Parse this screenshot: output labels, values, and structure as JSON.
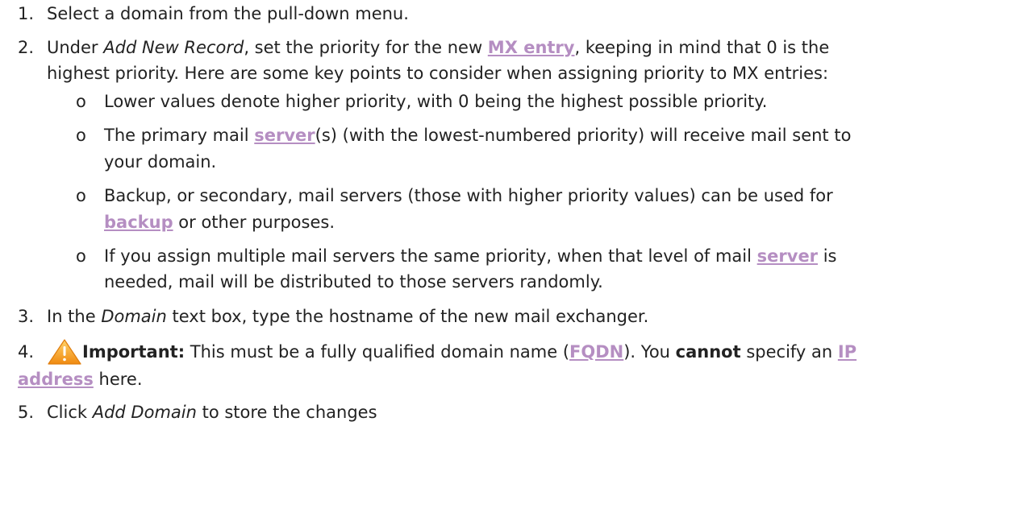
{
  "steps": [
    {
      "number": "1.",
      "text": "Select a domain from the pull-down menu."
    },
    {
      "number": "2.",
      "line1": {
        "pre": "Under ",
        "italic": "Add New Record",
        "mid": ", set the priority for the new ",
        "link": "MX entry",
        "post": ", keeping in mind that 0 is the"
      },
      "line2": "highest priority. Here are some key points to consider when assigning priority to MX entries:",
      "bullets": [
        {
          "marker": "o",
          "line1": "Lower values denote higher priority, with 0 being the highest possible priority."
        },
        {
          "marker": "o",
          "line1_pre": "The primary mail ",
          "line1_link": "server",
          "line1_post": "(s) (with the lowest-numbered priority) will receive mail sent to",
          "line2": "your domain."
        },
        {
          "marker": "o",
          "line1": "Backup, or secondary, mail servers (those with higher priority values) can be used for",
          "line2_link": "backup",
          "line2_post": " or other purposes."
        },
        {
          "marker": "o",
          "line1_pre": "If you assign multiple mail servers the same priority, when that level of mail ",
          "line1_link": "server",
          "line1_post": " is",
          "line2": "needed, mail will be distributed to those servers randomly."
        }
      ]
    },
    {
      "number": "3.",
      "pre": "In the ",
      "italic": "Domain",
      "post": " text box, type the hostname of the new mail exchanger."
    },
    {
      "number": "4.",
      "icon": "warning-icon",
      "bold_label": "Important:",
      "pre": " This must be a fully qualified domain name (",
      "link1": "FQDN",
      "mid1": "). You ",
      "bold_cannot": "cannot",
      "mid2": " specify an ",
      "link2_part1": "IP",
      "link2_part2": "address",
      "post": " here."
    },
    {
      "number": "5.",
      "pre": "Click ",
      "italic": "Add Domain",
      "post": " to store the changes"
    }
  ],
  "colors": {
    "text": "#222222",
    "link": "#b58ec2",
    "warning_fill": "#f5a623"
  }
}
